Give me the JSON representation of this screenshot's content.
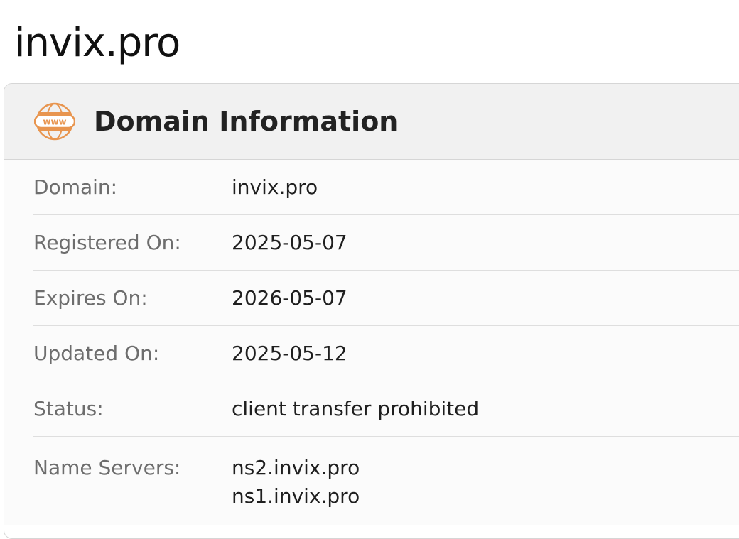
{
  "page": {
    "title": "invix.pro"
  },
  "card": {
    "title": "Domain Information",
    "icon": "www-globe-icon",
    "accent_color": "#e8954f"
  },
  "rows": {
    "domain": {
      "label": "Domain:",
      "value": "invix.pro"
    },
    "registered": {
      "label": "Registered On:",
      "value": "2025-05-07"
    },
    "expires": {
      "label": "Expires On:",
      "value": "2026-05-07"
    },
    "updated": {
      "label": "Updated On:",
      "value": "2025-05-12"
    },
    "status": {
      "label": "Status:",
      "value": "client transfer prohibited"
    },
    "name_servers": {
      "label": "Name Servers:",
      "values": [
        "ns2.invix.pro",
        "ns1.invix.pro"
      ]
    }
  }
}
